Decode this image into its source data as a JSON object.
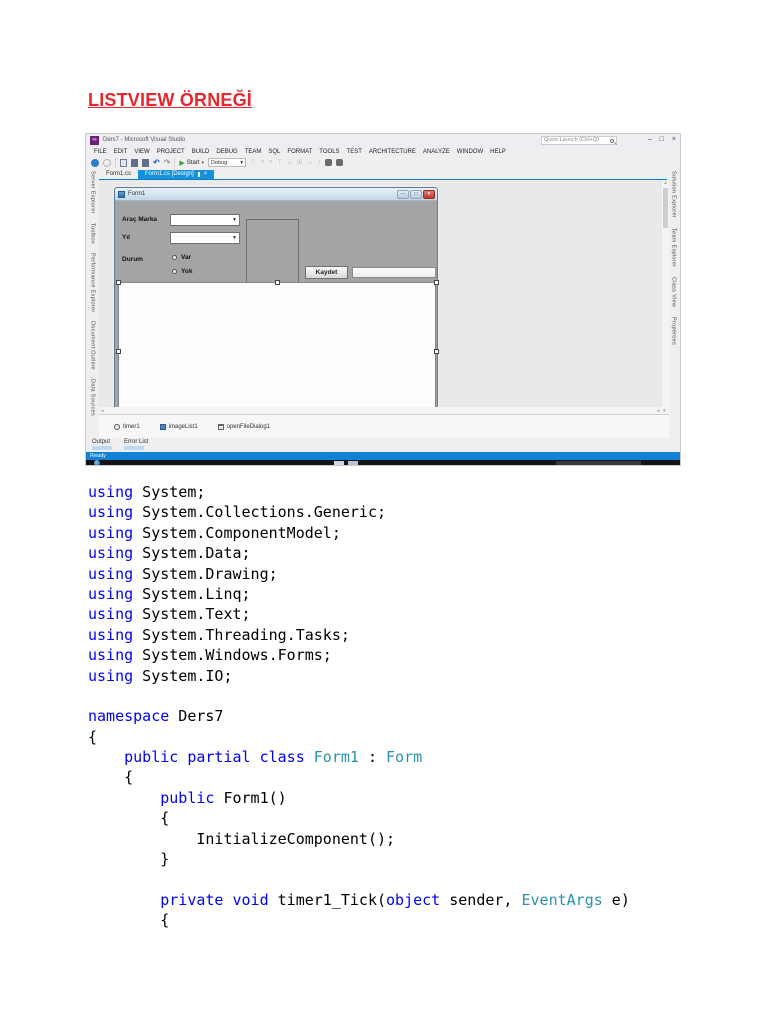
{
  "page": {
    "title": "LISTVIEW ÖRNEĞİ"
  },
  "vs": {
    "window_title": "Ders7 - Microsoft Visual Studio",
    "quick_launch_placeholder": "Quick Launch (Ctrl+Q)",
    "accent_color": "#007ACC",
    "menus": [
      "FILE",
      "EDIT",
      "VIEW",
      "PROJECT",
      "BUILD",
      "DEBUG",
      "TEAM",
      "SQL",
      "FORMAT",
      "TOOLS",
      "TEST",
      "ARCHITECTURE",
      "ANALYZE",
      "WINDOW",
      "HELP"
    ],
    "toolbar": {
      "start_label": "Start",
      "config_label": "Debug"
    },
    "tabs": [
      {
        "label": "Form1.cs",
        "active": false
      },
      {
        "label": "Form1.cs [Design]",
        "active": true
      }
    ],
    "left_panels": [
      "Server Explorer",
      "Toolbox",
      "Performance Explorer",
      "Document Outline",
      "Data Sources"
    ],
    "right_panels": [
      "Solution Explorer",
      "Team Explorer",
      "Class View",
      "Properties"
    ],
    "form": {
      "title": "Form1",
      "labels": {
        "brand": "Araç Marka",
        "year": "Yıl",
        "status": "Durum"
      },
      "radios": [
        "Var",
        "Yok"
      ],
      "save_button": "Kaydet"
    },
    "tray": [
      "timer1",
      "imageList1",
      "openFileDialog1"
    ],
    "bottom_tabs": [
      "Output",
      "Error List"
    ],
    "status": "Ready"
  },
  "code": {
    "keyword_color": "#0101fd",
    "type_color": "#2b91af",
    "lines": [
      [
        {
          "t": "using",
          "c": "k"
        },
        {
          "t": " System;",
          "c": "p"
        }
      ],
      [
        {
          "t": "using",
          "c": "k"
        },
        {
          "t": " System.Collections.Generic;",
          "c": "p"
        }
      ],
      [
        {
          "t": "using",
          "c": "k"
        },
        {
          "t": " System.ComponentModel;",
          "c": "p"
        }
      ],
      [
        {
          "t": "using",
          "c": "k"
        },
        {
          "t": " System.Data;",
          "c": "p"
        }
      ],
      [
        {
          "t": "using",
          "c": "k"
        },
        {
          "t": " System.Drawing;",
          "c": "p"
        }
      ],
      [
        {
          "t": "using",
          "c": "k"
        },
        {
          "t": " System.Linq;",
          "c": "p"
        }
      ],
      [
        {
          "t": "using",
          "c": "k"
        },
        {
          "t": " System.Text;",
          "c": "p"
        }
      ],
      [
        {
          "t": "using",
          "c": "k"
        },
        {
          "t": " System.Threading.Tasks;",
          "c": "p"
        }
      ],
      [
        {
          "t": "using",
          "c": "k"
        },
        {
          "t": " System.Windows.Forms;",
          "c": "p"
        }
      ],
      [
        {
          "t": "using",
          "c": "k"
        },
        {
          "t": " System.IO;",
          "c": "p"
        }
      ],
      [],
      [
        {
          "t": "namespace",
          "c": "k"
        },
        {
          "t": " Ders7",
          "c": "p"
        }
      ],
      [
        {
          "t": "{",
          "c": "p"
        }
      ],
      [
        {
          "t": "    ",
          "c": "p"
        },
        {
          "t": "public partial class",
          "c": "k"
        },
        {
          "t": " ",
          "c": "p"
        },
        {
          "t": "Form1",
          "c": "t"
        },
        {
          "t": " : ",
          "c": "p"
        },
        {
          "t": "Form",
          "c": "t"
        }
      ],
      [
        {
          "t": "    {",
          "c": "p"
        }
      ],
      [
        {
          "t": "        ",
          "c": "p"
        },
        {
          "t": "public",
          "c": "k"
        },
        {
          "t": " Form1()",
          "c": "p"
        }
      ],
      [
        {
          "t": "        {",
          "c": "p"
        }
      ],
      [
        {
          "t": "            InitializeComponent();",
          "c": "p"
        }
      ],
      [
        {
          "t": "        }",
          "c": "p"
        }
      ],
      [],
      [
        {
          "t": "        ",
          "c": "p"
        },
        {
          "t": "private void",
          "c": "k"
        },
        {
          "t": " timer1_Tick(",
          "c": "p"
        },
        {
          "t": "object",
          "c": "k"
        },
        {
          "t": " sender, ",
          "c": "p"
        },
        {
          "t": "EventArgs",
          "c": "t"
        },
        {
          "t": " e)",
          "c": "p"
        }
      ],
      [
        {
          "t": "        {",
          "c": "p"
        }
      ]
    ]
  }
}
